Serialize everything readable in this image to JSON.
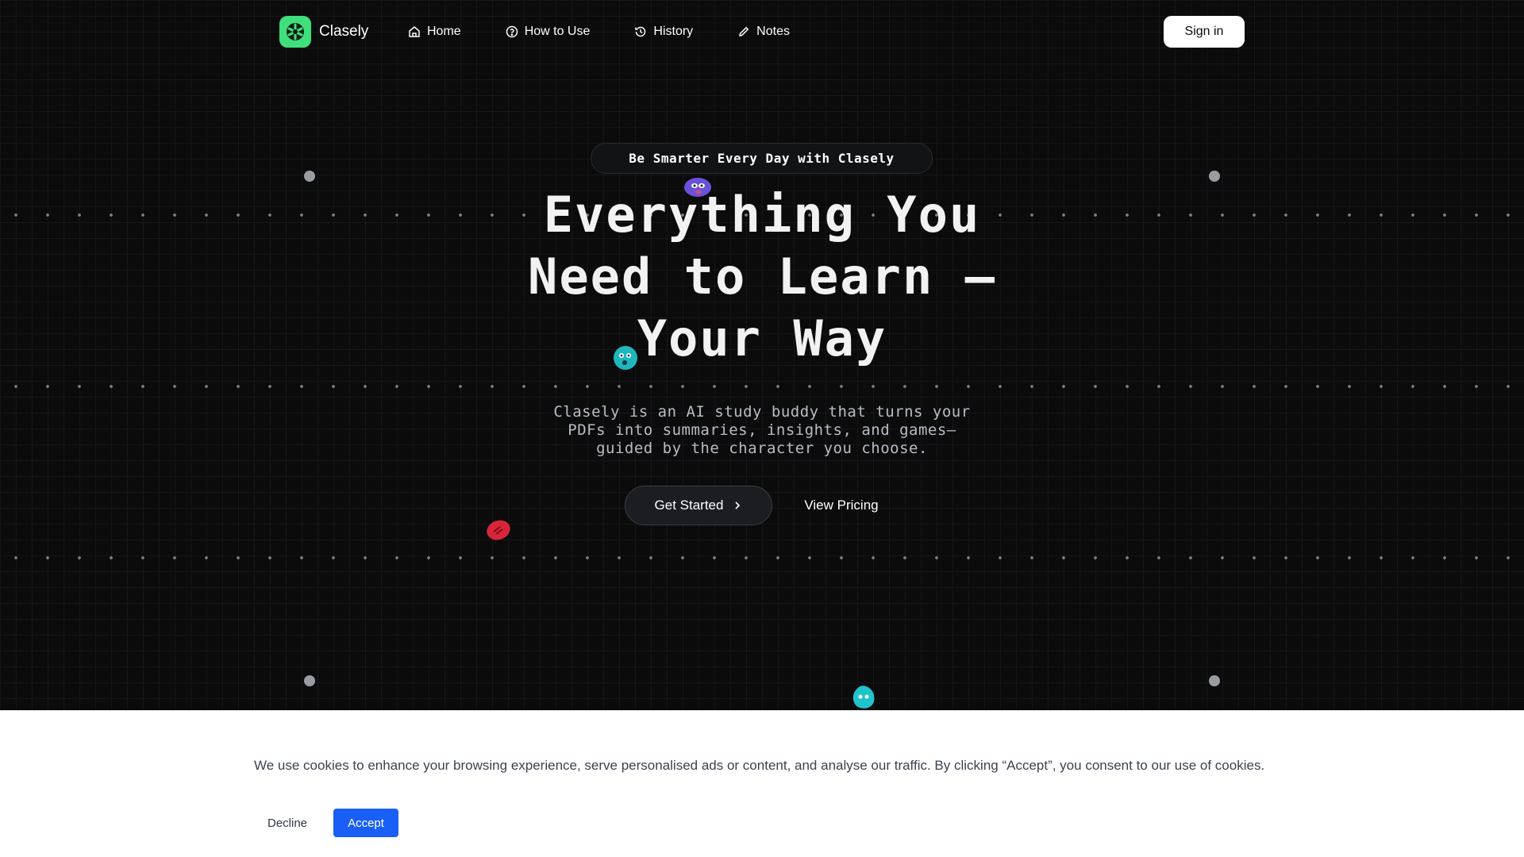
{
  "brand": {
    "name": "Clasely",
    "logo_color": "#3fe07c"
  },
  "nav": {
    "links": [
      {
        "label": "Home",
        "icon": "home-icon"
      },
      {
        "label": "How to Use",
        "icon": "help-circle-icon"
      },
      {
        "label": "History",
        "icon": "history-icon"
      },
      {
        "label": "Notes",
        "icon": "pencil-icon"
      }
    ],
    "signin_label": "Sign in"
  },
  "hero": {
    "badge": "Be Smarter Every Day with Clasely",
    "headline_lines": [
      "Everything You",
      "Need to Learn —",
      "Your Way"
    ],
    "subtitle_lines": [
      "Clasely is an AI study buddy that turns your",
      "PDFs into summaries, insights, and games—",
      "guided by the character you choose."
    ],
    "cta_label": "Get Started",
    "secondary_label": "View Pricing"
  },
  "cookie_banner": {
    "text": "We use cookies to enhance your browsing experience, serve personalised ads or content, and analyse our traffic. By clicking “Accept”, you consent to our use of cookies.",
    "decline_label": "Decline",
    "accept_label": "Accept",
    "accept_color": "#1a5ff5"
  },
  "colors": {
    "background": "#0b0b0c",
    "text": "#ffffff"
  }
}
